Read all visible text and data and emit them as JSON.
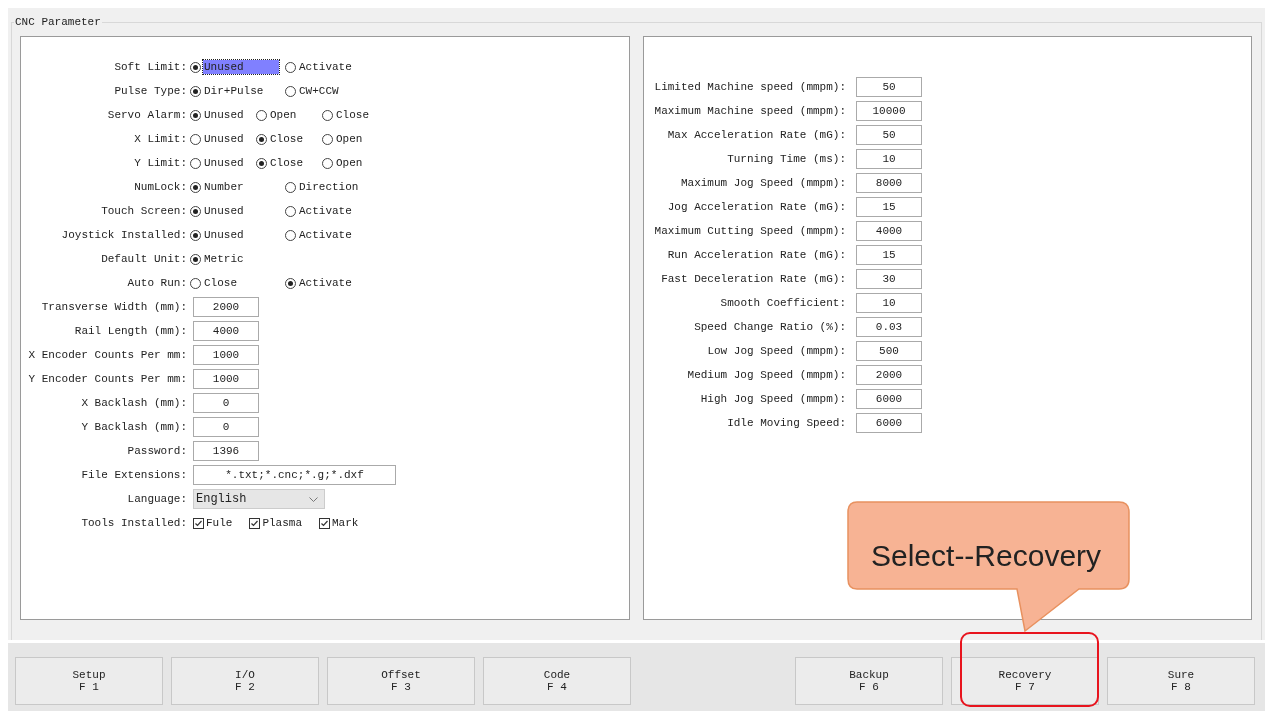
{
  "group_title": "CNC Parameter",
  "left_fields": [
    {
      "kind": "radio",
      "label": "Soft Limit:",
      "options": [
        {
          "label": "Unused",
          "selected": true,
          "focused": true
        },
        {
          "label": "Activate",
          "selected": false,
          "focused": false
        }
      ]
    },
    {
      "kind": "radio",
      "label": "Pulse Type:",
      "options": [
        {
          "label": "Dir+Pulse",
          "selected": true,
          "focused": false
        },
        {
          "label": "CW+CCW",
          "selected": false,
          "focused": false
        }
      ]
    },
    {
      "kind": "radio",
      "label": "Servo Alarm:",
      "options": [
        {
          "label": "Unused",
          "selected": true,
          "focused": false
        },
        {
          "label": "Open",
          "selected": false,
          "focused": false
        },
        {
          "label": "Close",
          "selected": false,
          "focused": false
        }
      ]
    },
    {
      "kind": "radio",
      "label": "X Limit:",
      "options": [
        {
          "label": "Unused",
          "selected": false,
          "focused": false
        },
        {
          "label": "Close",
          "selected": true,
          "focused": false
        },
        {
          "label": "Open",
          "selected": false,
          "focused": false
        }
      ]
    },
    {
      "kind": "radio",
      "label": "Y Limit:",
      "options": [
        {
          "label": "Unused",
          "selected": false,
          "focused": false
        },
        {
          "label": "Close",
          "selected": true,
          "focused": false
        },
        {
          "label": "Open",
          "selected": false,
          "focused": false
        }
      ]
    },
    {
      "kind": "radio",
      "label": "NumLock:",
      "options": [
        {
          "label": "Number",
          "selected": true,
          "focused": false
        },
        {
          "label": "Direction",
          "selected": false,
          "focused": false
        }
      ]
    },
    {
      "kind": "radio",
      "label": "Touch Screen:",
      "options": [
        {
          "label": "Unused",
          "selected": true,
          "focused": false
        },
        {
          "label": "Activate",
          "selected": false,
          "focused": false
        }
      ]
    },
    {
      "kind": "radio",
      "label": "Joystick Installed:",
      "options": [
        {
          "label": "Unused",
          "selected": true,
          "focused": false
        },
        {
          "label": "Activate",
          "selected": false,
          "focused": false
        }
      ]
    },
    {
      "kind": "radio",
      "label": "Default Unit:",
      "options": [
        {
          "label": "Metric",
          "selected": true,
          "focused": false
        }
      ]
    },
    {
      "kind": "radio",
      "label": "Auto Run:",
      "options": [
        {
          "label": "Close",
          "selected": false,
          "focused": false
        },
        {
          "label": "Activate",
          "selected": true,
          "focused": false
        }
      ]
    },
    {
      "kind": "input",
      "label": "Transverse Width (mm):",
      "value": "2000"
    },
    {
      "kind": "input",
      "label": "Rail Length (mm):",
      "value": "4000"
    },
    {
      "kind": "input",
      "label": "X Encoder Counts Per mm:",
      "value": "1000"
    },
    {
      "kind": "input",
      "label": "Y Encoder Counts Per mm:",
      "value": "1000"
    },
    {
      "kind": "input",
      "label": "X Backlash (mm):",
      "value": "0"
    },
    {
      "kind": "input",
      "label": "Y Backlash (mm):",
      "value": "0"
    },
    {
      "kind": "input",
      "label": "Password:",
      "value": "1396"
    },
    {
      "kind": "wide_input",
      "label": "File Extensions:",
      "value": "*.txt;*.cnc;*.g;*.dxf"
    },
    {
      "kind": "select",
      "label": "Language:",
      "value": "English"
    },
    {
      "kind": "checkbox",
      "label": "Tools Installed:",
      "options": [
        {
          "label": "Fule",
          "checked": true
        },
        {
          "label": "Plasma",
          "checked": true
        },
        {
          "label": "Mark",
          "checked": true
        }
      ]
    }
  ],
  "right_fields": [
    {
      "label": "Limited Machine speed (mmpm):",
      "value": "50"
    },
    {
      "label": "Maximum Machine speed (mmpm):",
      "value": "10000"
    },
    {
      "label": "Max Acceleration Rate (mG):",
      "value": "50"
    },
    {
      "label": "Turning Time (ms):",
      "value": "10"
    },
    {
      "label": "Maximum Jog Speed (mmpm):",
      "value": "8000"
    },
    {
      "label": "Jog Acceleration Rate (mG):",
      "value": "15"
    },
    {
      "label": "Maximum Cutting Speed (mmpm):",
      "value": "4000"
    },
    {
      "label": "Run Acceleration Rate (mG):",
      "value": "15"
    },
    {
      "label": "Fast Deceleration Rate (mG):",
      "value": "30"
    },
    {
      "label": "Smooth Coefficient:",
      "value": "10"
    },
    {
      "label": "Speed Change Ratio (%):",
      "value": "0.03"
    },
    {
      "label": "Low Jog Speed (mmpm):",
      "value": "500"
    },
    {
      "label": "Medium Jog Speed (mmpm):",
      "value": "2000"
    },
    {
      "label": "High Jog Speed (mmpm):",
      "value": "6000"
    },
    {
      "label": "Idle Moving Speed:",
      "value": "6000"
    }
  ],
  "function_keys": [
    {
      "kind": "left",
      "label": "Setup",
      "key": "F 1",
      "highlighted": false
    },
    {
      "kind": "left",
      "label": "I/O",
      "key": "F 2",
      "highlighted": false
    },
    {
      "kind": "left",
      "label": "Offset",
      "key": "F 3",
      "highlighted": false
    },
    {
      "kind": "left",
      "label": "Code",
      "key": "F 4",
      "highlighted": false
    },
    {
      "kind": "right",
      "label": "Backup",
      "key": "F 6",
      "highlighted": false
    },
    {
      "kind": "right",
      "label": "Recovery",
      "key": "F 7",
      "highlighted": true
    },
    {
      "kind": "right",
      "label": "Sure",
      "key": "F 8",
      "highlighted": false
    }
  ],
  "callout": {
    "text": "Select--Recovery"
  }
}
